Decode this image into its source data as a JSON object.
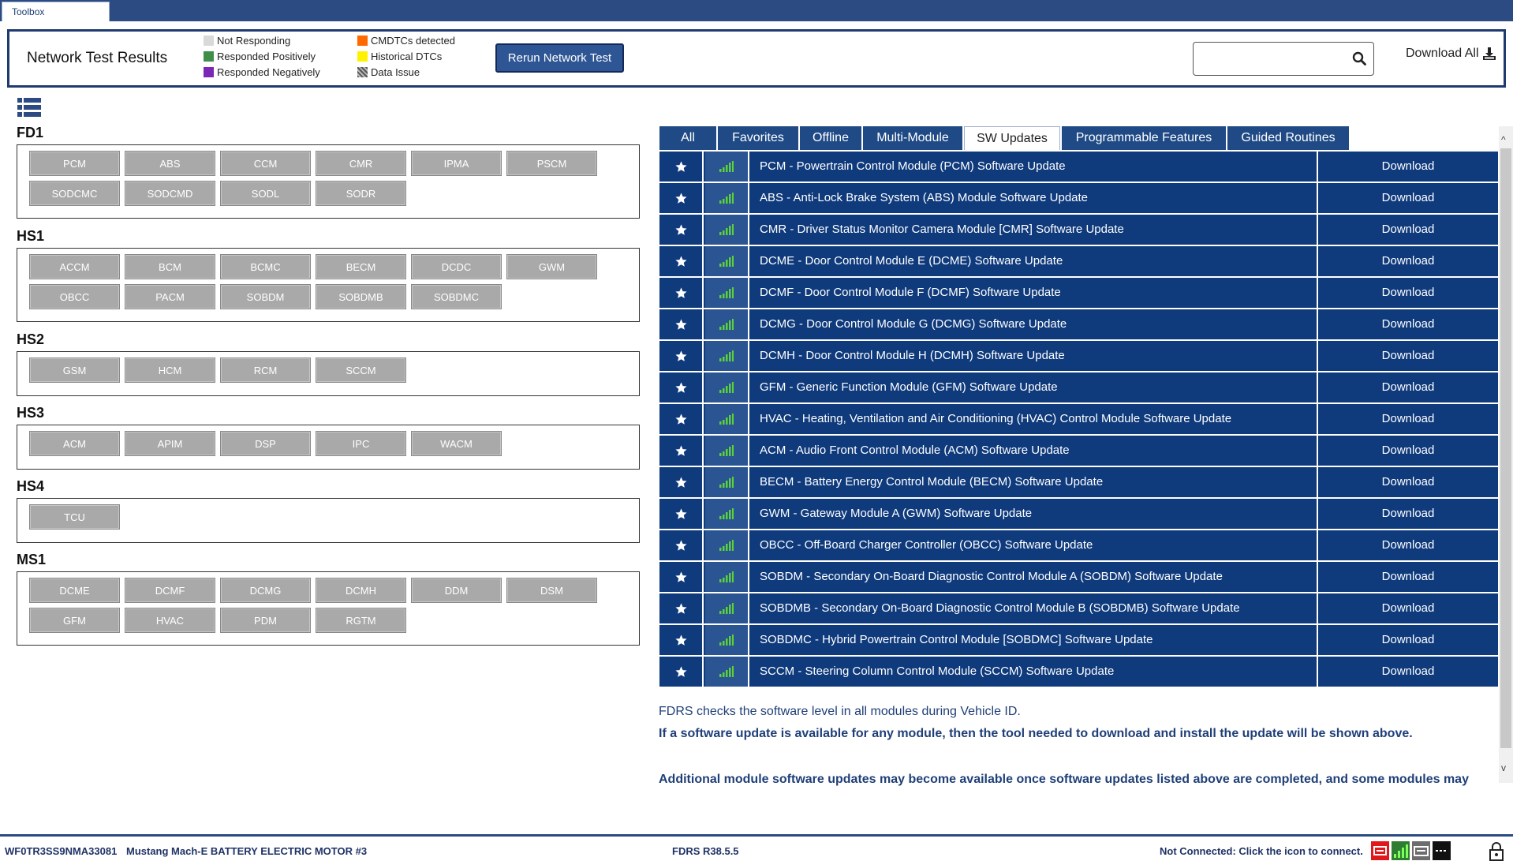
{
  "app": {
    "tab_label": "Toolbox"
  },
  "header": {
    "title": "Network Test Results",
    "legend": [
      {
        "label": "Not Responding",
        "color": "#d9d9d9"
      },
      {
        "label": "Responded Positively",
        "color": "#3f8f4a"
      },
      {
        "label": "Responded Negatively",
        "color": "#7b28b6"
      },
      {
        "label": "CMDTCs detected",
        "color": "#ff6a00"
      },
      {
        "label": "Historical DTCs",
        "color": "#fff200"
      },
      {
        "label": "Data Issue",
        "color": "#8a8a8a"
      }
    ],
    "rerun_label": "Rerun Network Test",
    "search_placeholder": "",
    "download_all_label": "Download All"
  },
  "groups": [
    {
      "name": "FD1",
      "modules": [
        "PCM",
        "ABS",
        "CCM",
        "CMR",
        "IPMA",
        "PSCM",
        "SODCMC",
        "SODCMD",
        "SODL",
        "SODR"
      ]
    },
    {
      "name": "HS1",
      "modules": [
        "ACCM",
        "BCM",
        "BCMC",
        "BECM",
        "DCDC",
        "GWM",
        "OBCC",
        "PACM",
        "SOBDM",
        "SOBDMB",
        "SOBDMC"
      ]
    },
    {
      "name": "HS2",
      "modules": [
        "GSM",
        "HCM",
        "RCM",
        "SCCM"
      ]
    },
    {
      "name": "HS3",
      "modules": [
        "ACM",
        "APIM",
        "DSP",
        "IPC",
        "WACM"
      ]
    },
    {
      "name": "HS4",
      "modules": [
        "TCU"
      ]
    },
    {
      "name": "MS1",
      "modules": [
        "DCME",
        "DCMF",
        "DCMG",
        "DCMH",
        "DDM",
        "DSM",
        "GFM",
        "HVAC",
        "PDM",
        "RGTM"
      ]
    }
  ],
  "tabs": [
    "All",
    "Favorites",
    "Offline",
    "Multi-Module",
    "SW Updates",
    "Programmable Features",
    "Guided Routines"
  ],
  "active_tab": "SW Updates",
  "updates": [
    {
      "text": "PCM - Powertrain Control Module (PCM) Software Update",
      "action": "Download"
    },
    {
      "text": "ABS - Anti-Lock Brake System (ABS) Module Software Update",
      "action": "Download"
    },
    {
      "text": "CMR - Driver Status Monitor Camera Module [CMR] Software Update",
      "action": "Download"
    },
    {
      "text": "DCME - Door Control Module E (DCME) Software Update",
      "action": "Download"
    },
    {
      "text": "DCMF - Door Control Module F (DCMF) Software Update",
      "action": "Download"
    },
    {
      "text": "DCMG - Door Control Module G (DCMG) Software Update",
      "action": "Download"
    },
    {
      "text": "DCMH - Door Control Module H (DCMH) Software Update",
      "action": "Download"
    },
    {
      "text": "GFM - Generic Function Module (GFM) Software Update",
      "action": "Download"
    },
    {
      "text": "HVAC - Heating, Ventilation and Air Conditioning (HVAC) Control Module Software Update",
      "action": "Download"
    },
    {
      "text": "ACM - Audio Front Control Module (ACM) Software Update",
      "action": "Download"
    },
    {
      "text": "BECM - Battery Energy Control Module (BECM) Software Update",
      "action": "Download"
    },
    {
      "text": "GWM - Gateway Module A (GWM) Software Update",
      "action": "Download"
    },
    {
      "text": "OBCC - Off-Board Charger Controller (OBCC) Software Update",
      "action": "Download"
    },
    {
      "text": "SOBDM - Secondary On-Board Diagnostic Control Module A (SOBDM) Software Update",
      "action": "Download"
    },
    {
      "text": "SOBDMB - Secondary On-Board Diagnostic Control Module B (SOBDMB) Software Update",
      "action": "Download"
    },
    {
      "text": "SOBDMC - Hybrid Powertrain Control Module [SOBDMC] Software Update",
      "action": "Download"
    },
    {
      "text": "SCCM - Steering Column Control Module (SCCM) Software Update",
      "action": "Download"
    }
  ],
  "info": {
    "line1": "FDRS checks the software level in all modules during Vehicle ID.",
    "line2": "If a software update is available for any module, then the tool needed to download and install the update will be shown above.",
    "line3": "Additional module software updates may become available once software updates listed above are completed, and some modules may"
  },
  "status": {
    "vin": "WF0TR3SS9NMA33081",
    "vehicle": "Mustang Mach-E BATTERY ELECTRIC MOTOR #3",
    "version": "FDRS R38.5.5",
    "connection": "Not Connected: Click the icon to connect."
  },
  "icons": [
    "search-icon",
    "download-icon",
    "list-view-icon",
    "star-icon",
    "signal-icon",
    "vci-icon",
    "lock-icon"
  ],
  "colors": {
    "header_blue": "#2b4b82",
    "row_blue": "#0f3a7c",
    "signal_green": "#5bd13a",
    "module_gray": "#a9a9a9"
  }
}
